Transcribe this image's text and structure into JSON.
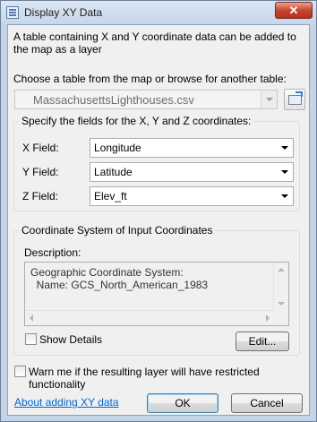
{
  "window": {
    "title": "Display XY Data",
    "close_label": "✕"
  },
  "intro": "A table containing X and Y coordinate data can be added to the map as a layer",
  "table": {
    "label": "Choose a table from the map or browse for another table:",
    "value": "MassachusettsLighthouses.csv"
  },
  "fields": {
    "title": "Specify the fields for the X, Y and Z coordinates:",
    "x_label": "X Field:",
    "x_value": "Longitude",
    "y_label": "Y Field:",
    "y_value": "Latitude",
    "z_label": "Z Field:",
    "z_value": "Elev_ft"
  },
  "coords": {
    "title": "Coordinate System of Input Coordinates",
    "desc_label": "Description:",
    "desc_text": "Geographic Coordinate System:\n  Name: GCS_North_American_1983",
    "show_details": "Show Details",
    "edit": "Edit..."
  },
  "warn": "Warn me if the resulting layer will have restricted functionality",
  "footer": {
    "help_link": "About adding XY data",
    "ok": "OK",
    "cancel": "Cancel"
  }
}
